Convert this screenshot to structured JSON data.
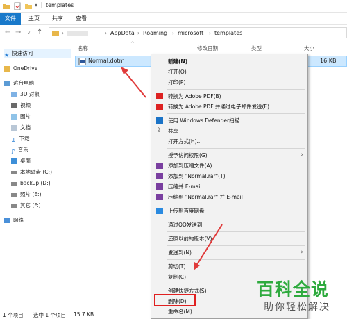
{
  "window": {
    "title": "templates"
  },
  "ribbon": {
    "tabs": [
      "文件",
      "主页",
      "共享",
      "查看"
    ]
  },
  "address": {
    "path": [
      "AppData",
      "Roaming",
      "microsoft",
      "templates"
    ]
  },
  "navpane": {
    "items": [
      {
        "label": "快速访问",
        "icon": "star-icon"
      },
      {
        "label": "OneDrive",
        "icon": "folder-icon"
      },
      {
        "label": "这台电脑",
        "icon": "computer-icon"
      },
      {
        "label": "3D 对象",
        "icon": "cube-icon"
      },
      {
        "label": "视频",
        "icon": "video-icon"
      },
      {
        "label": "图片",
        "icon": "picture-icon"
      },
      {
        "label": "文档",
        "icon": "document-icon"
      },
      {
        "label": "下载",
        "icon": "download-icon"
      },
      {
        "label": "音乐",
        "icon": "music-icon"
      },
      {
        "label": "桌面",
        "icon": "desktop-icon"
      },
      {
        "label": "本地磁盘 (C:)",
        "icon": "drive-icon"
      },
      {
        "label": "backup (D:)",
        "icon": "drive-icon"
      },
      {
        "label": "照片 (E:)",
        "icon": "drive-icon"
      },
      {
        "label": "其它 (F:)",
        "icon": "drive-icon"
      },
      {
        "label": "网络",
        "icon": "network-icon"
      }
    ]
  },
  "columns": {
    "name": "名称",
    "date": "修改日期",
    "type": "类型",
    "size": "大小"
  },
  "file": {
    "name": "Normal.dotm",
    "size": "16 KB"
  },
  "context_menu": {
    "groups": [
      [
        {
          "label": "新建(N)",
          "bold": true
        },
        {
          "label": "打开(O)"
        },
        {
          "label": "打印(P)"
        }
      ],
      [
        {
          "label": "转换为 Adobe PDF(B)",
          "icon": "pdf-icon"
        },
        {
          "label": "转换为 Adobe PDF 并通过电子邮件发送(E)",
          "icon": "pdf-icon"
        }
      ],
      [
        {
          "label": "使用 Windows Defender扫描...",
          "icon": "shield-icon"
        },
        {
          "label": "共享",
          "icon": "share-icon"
        },
        {
          "label": "打开方式(H)..."
        }
      ],
      [
        {
          "label": "授予访问权限(G)",
          "submenu": true
        },
        {
          "label": "添加到压缩文件(A)...",
          "icon": "archive-icon"
        },
        {
          "label": "添加到 \"Normal.rar\"(T)",
          "icon": "archive-icon"
        },
        {
          "label": "压缩并 E-mail...",
          "icon": "archive-icon"
        },
        {
          "label": "压缩到 \"Normal.rar\" 并 E-mail",
          "icon": "archive-icon"
        }
      ],
      [
        {
          "label": "上传到百度网盘",
          "icon": "cloud-icon"
        }
      ],
      [
        {
          "label": "通过QQ发送到"
        }
      ],
      [
        {
          "label": "还原以前的版本(V)"
        }
      ],
      [
        {
          "label": "发送到(N)",
          "submenu": true
        }
      ],
      [
        {
          "label": "剪切(T)"
        },
        {
          "label": "复制(C)"
        }
      ],
      [
        {
          "label": "创建快捷方式(S)"
        },
        {
          "label": "删除(D)"
        },
        {
          "label": "重命名(M)"
        }
      ]
    ]
  },
  "status": {
    "count": "1 个项目",
    "selected": "选中 1 个项目",
    "size": "15.7 KB"
  },
  "watermark": {
    "title": "百科全说",
    "subtitle": "助你轻松解决"
  },
  "colors": {
    "accent": "#1979ca",
    "selection": "#cce8ff",
    "highlight_border": "#e02020",
    "arrow": "#e03a3a",
    "watermark": "#2eaa3e"
  }
}
